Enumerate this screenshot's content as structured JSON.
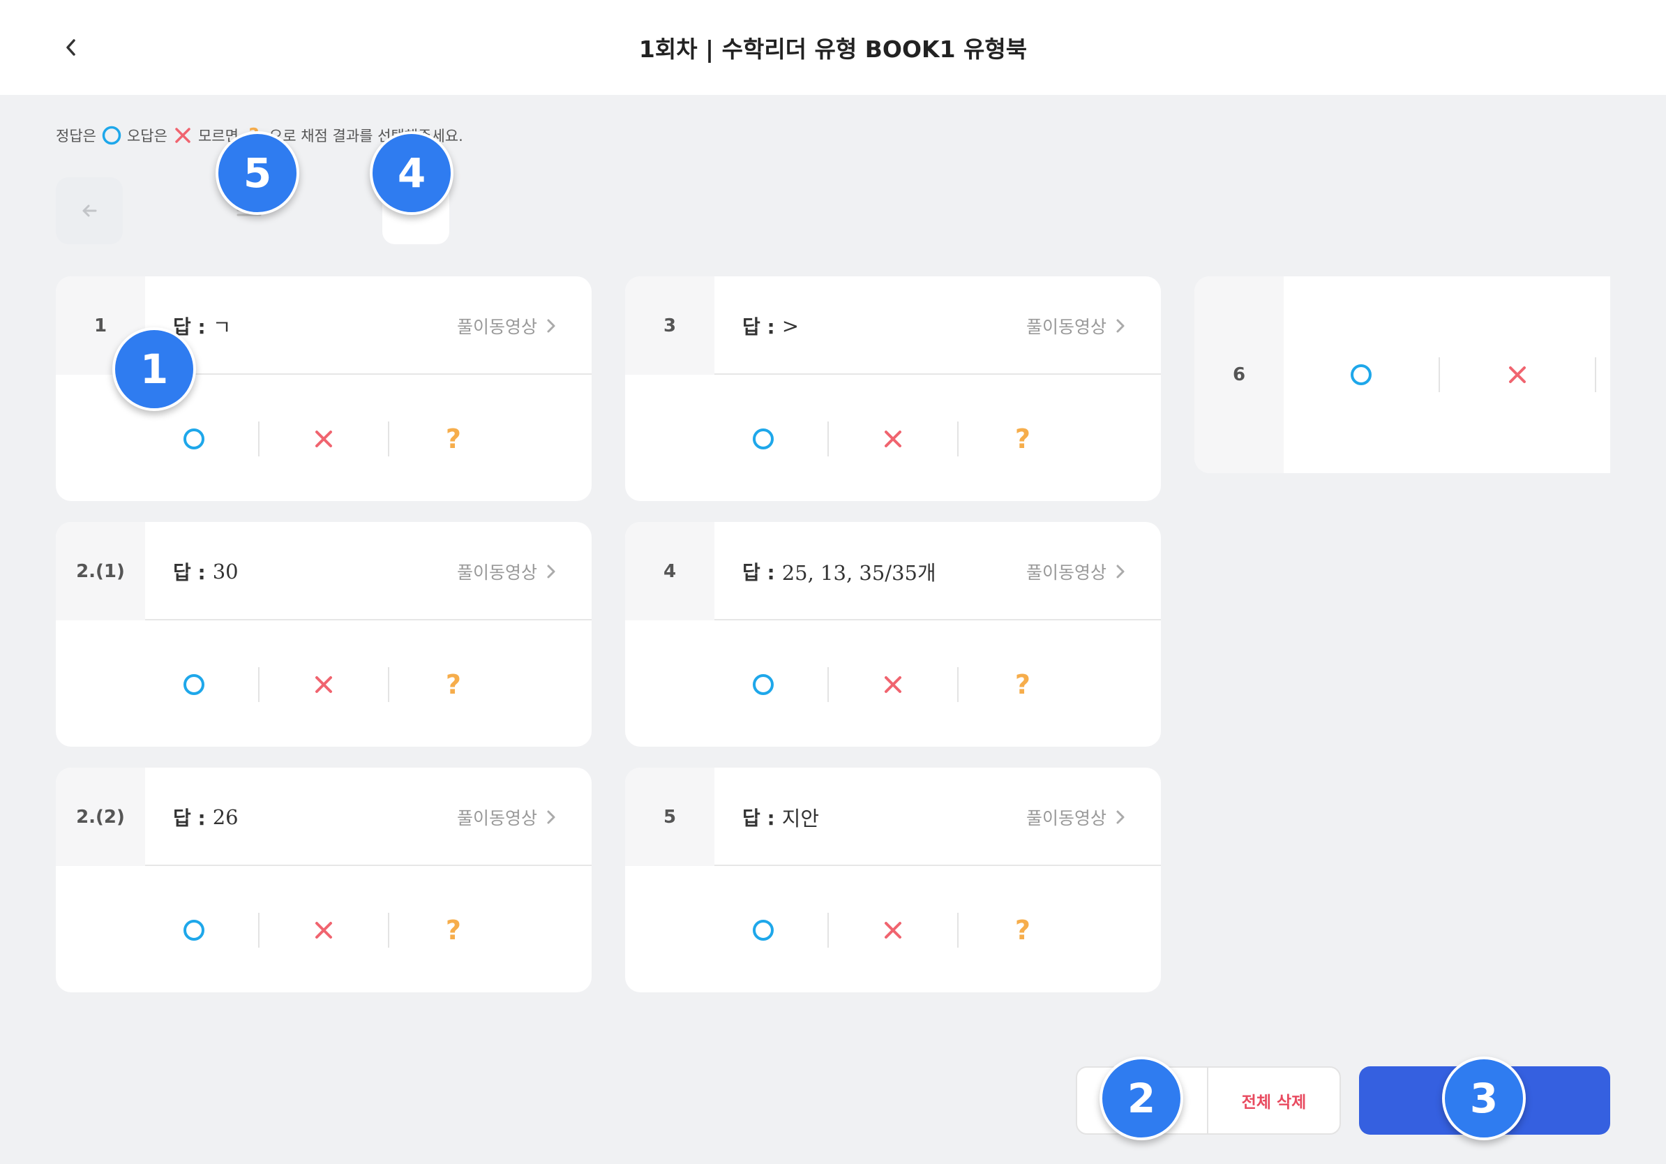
{
  "header": {
    "title": "1회차 | 수학리더 유형 BOOK1 유형북"
  },
  "instruction": {
    "part1": "정답은",
    "part2": "오답은",
    "part3": "모르면",
    "part4": "으로 채점 결과를 선택해주세요."
  },
  "labels": {
    "answer": "답 :",
    "video": "풀이동영상"
  },
  "questions": [
    {
      "number": "1",
      "answer": "ㄱ"
    },
    {
      "number": "2.(1)",
      "answer": "30"
    },
    {
      "number": "2.(2)",
      "answer": "26"
    },
    {
      "number": "3",
      "answer": ">"
    },
    {
      "number": "4",
      "answer": "25, 13, 35/35개"
    },
    {
      "number": "5",
      "answer": "지안"
    },
    {
      "number": "6",
      "answer": ""
    }
  ],
  "buttons": {
    "delete_all": "전체 삭제"
  },
  "badges": [
    "1",
    "2",
    "3",
    "4",
    "5"
  ],
  "colors": {
    "correct": "#1ea7ea",
    "wrong": "#f0646f",
    "unknown": "#f6ad4b",
    "badge": "#2f7cf0",
    "submit": "#3560e0"
  }
}
